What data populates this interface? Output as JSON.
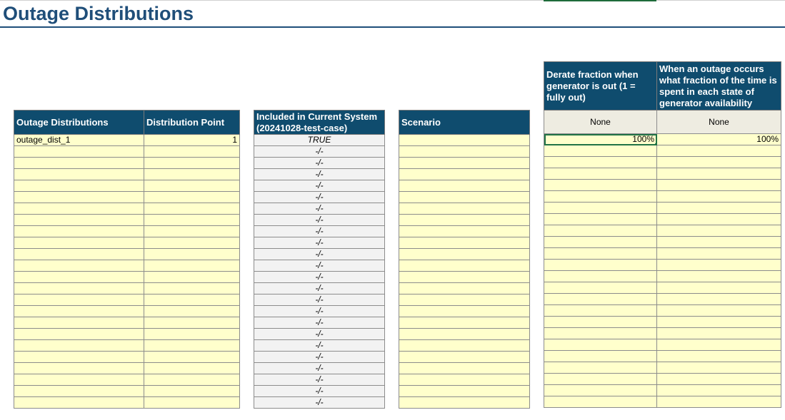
{
  "title": "Outage Distributions",
  "colors": {
    "header_bg": "#0F4C6E",
    "title": "#1F4E79",
    "cell_yellow": "#FFFFCC",
    "cell_gray": "#F2F2F2"
  },
  "table1": {
    "headers": [
      "Outage Distributions",
      "Distribution Point"
    ],
    "first_row": {
      "name": "outage_dist_1",
      "point": "1"
    }
  },
  "table2": {
    "header": "Included in Current System (20241028-test-case)",
    "first_value": "TRUE",
    "other_value": "-/-"
  },
  "table3": {
    "header": "Scenario"
  },
  "table4": {
    "headers": [
      "Derate fraction when generator is out (1 = fully out)",
      "When an outage occurs what fraction of the time is spent in each state of generator availability"
    ],
    "subheaders": [
      "None",
      "None"
    ],
    "first_row": [
      "100%",
      "100%"
    ]
  }
}
